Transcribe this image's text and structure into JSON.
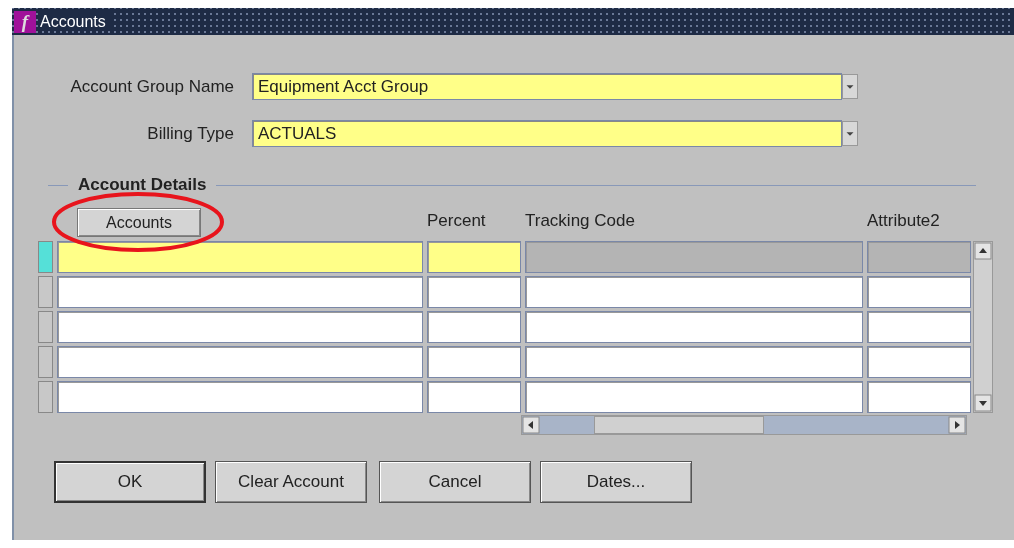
{
  "window": {
    "logo": "f",
    "title": "Accounts"
  },
  "fields": [
    {
      "label": "Account Group Name",
      "value": "Equipment Acct Group"
    },
    {
      "label": "Billing Type",
      "value": "ACTUALS"
    }
  ],
  "section": {
    "title": "Account Details"
  },
  "table": {
    "header_button": "Accounts",
    "columns": [
      "Percent",
      "Tracking Code",
      "Attribute2"
    ],
    "rows": [
      {
        "selected": true
      },
      {
        "selected": false
      },
      {
        "selected": false
      },
      {
        "selected": false
      },
      {
        "selected": false
      }
    ]
  },
  "buttons": [
    {
      "label": "OK",
      "default": true
    },
    {
      "label": "Clear Account",
      "default": false
    },
    {
      "label": "Cancel",
      "default": false
    },
    {
      "label": "Dates...",
      "default": false
    }
  ]
}
